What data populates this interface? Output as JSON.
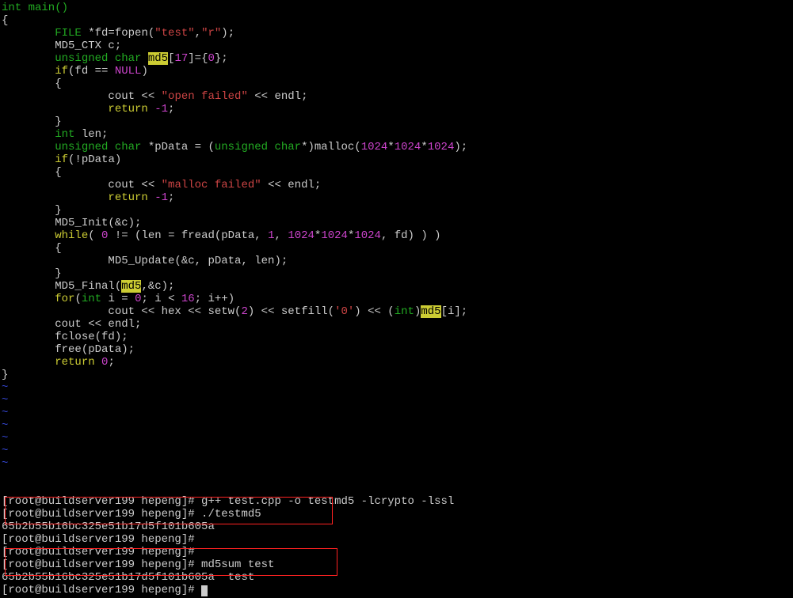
{
  "code": {
    "fn_decl": "int main()",
    "obrace": "{",
    "cbrace": "}",
    "line_file": {
      "kw": "FILE",
      "rest": " *fd=fopen(",
      "s1": "\"test\"",
      "c": ",",
      "s2": "\"r\"",
      "end": ");"
    },
    "line_ctx": "        MD5_CTX c;",
    "line_md5": {
      "pre": "        ",
      "kw": "unsigned char ",
      "hl": "md5",
      "rest": "[",
      "n": "17",
      "mid": "]={",
      "n2": "0",
      "end": "};"
    },
    "line_iffd": {
      "pre": "        ",
      "kw": "if",
      "rest": "(fd == ",
      "nul": "NULL",
      "end": ")"
    },
    "line_ob": "        {",
    "line_cb": "        }",
    "line_openfail": {
      "pre": "                cout << ",
      "s": "\"open failed\"",
      "rest": " << endl;"
    },
    "line_retm1": {
      "pre": "                ",
      "kw": "return ",
      "n": "-1",
      "end": ";"
    },
    "line_intlen": {
      "pre": "        ",
      "kw": "int",
      "rest": " len;"
    },
    "line_pdata": {
      "pre": "        ",
      "kw": "unsigned char ",
      "rest": "*pData = (",
      "kw2": "unsigned char",
      "rest2": "*)malloc(",
      "n1": "1024",
      "m1": "*",
      "n2": "1024",
      "m2": "*",
      "n3": "1024",
      "end": ");"
    },
    "line_ifpdata": {
      "pre": "        ",
      "kw": "if",
      "rest": "(!pData)"
    },
    "line_mallocfail": {
      "pre": "                cout << ",
      "s": "\"malloc failed\"",
      "rest": " << endl;"
    },
    "line_md5init": "        MD5_Init(&c);",
    "line_while": {
      "pre": "        ",
      "kw": "while",
      "rest": "( ",
      "n0": "0",
      "mid": " != (len = fread(pData, ",
      "n1": "1",
      "c1": ", ",
      "n2": "1024",
      "m1": "*",
      "n3": "1024",
      "m2": "*",
      "n4": "1024",
      "end": ", fd) ) )"
    },
    "line_md5upd": "                MD5_Update(&c, pData, len);",
    "line_md5final": {
      "pre": "        MD5_Final(",
      "hl": "md5",
      "end": ",&c);"
    },
    "line_for": {
      "pre": "        ",
      "kw": "for",
      "rest": "(",
      "kw2": "int",
      "rest2": " i = ",
      "n0": "0",
      "mid": "; i < ",
      "n1": "16",
      "end": "; i++)"
    },
    "line_cout": {
      "pre": "                cout << hex << setw(",
      "n": "2",
      "mid": ") << setfill(",
      "s": "'0'",
      "mid2": ") << (",
      "kw": "int",
      "mid3": ")",
      "hl": "md5",
      "end": "[i];"
    },
    "line_coutendl": "        cout << endl;",
    "line_fclose": "        fclose(fd);",
    "line_free": "        free(pData);",
    "line_ret0": {
      "pre": "        ",
      "kw": "return ",
      "n": "0",
      "end": ";"
    },
    "tilde": "~"
  },
  "term": {
    "l1": "[root@buildserver199 hepeng]# g++ test.cpp -o testmd5 -lcrypto -lssl",
    "l2": "[root@buildserver199 hepeng]# ./testmd5",
    "l3": "65b2b55b16bc325e51b17d5f101b605a",
    "l4": "[root@buildserver199 hepeng]#",
    "l5": "[root@buildserver199 hepeng]#",
    "l6": "[root@buildserver199 hepeng]# md5sum test",
    "l7": "65b2b55b16bc325e51b17d5f101b605a  test",
    "l8": "[root@buildserver199 hepeng]# "
  }
}
